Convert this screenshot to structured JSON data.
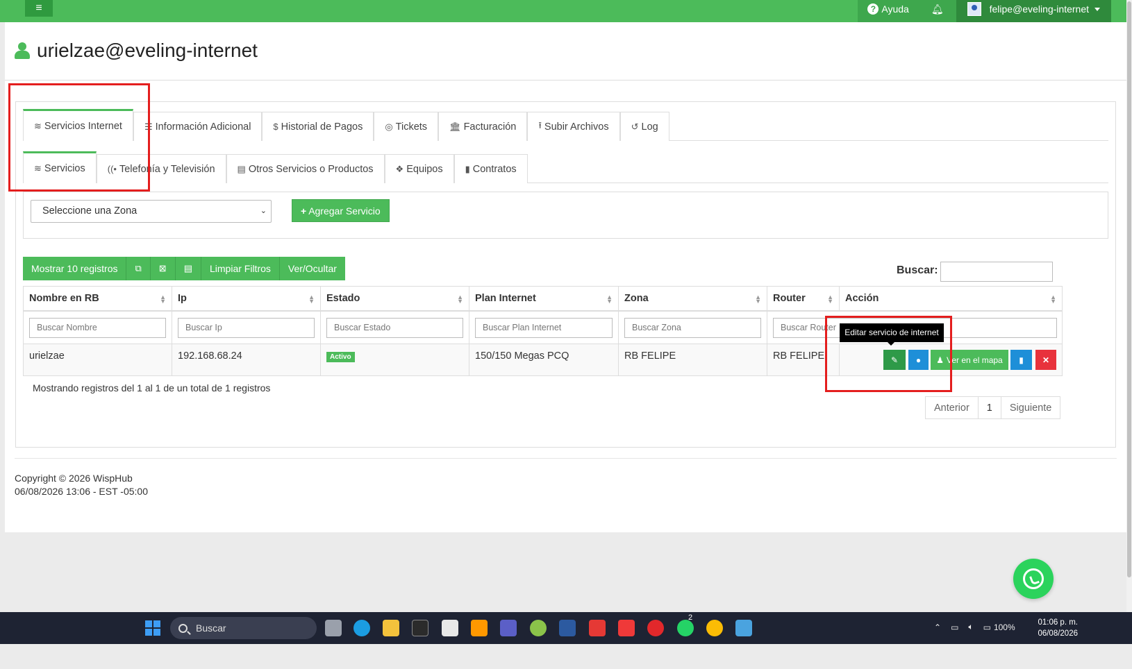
{
  "topbar": {
    "menu_icon": "hamburger-icon",
    "help_label": "Ayuda",
    "user_label": "felipe@eveling-internet"
  },
  "page": {
    "title": "urielzae@eveling-internet"
  },
  "tabs_primary": [
    {
      "label": "Servicios Internet",
      "icon": "wifi-icon"
    },
    {
      "label": "Información Adicional",
      "icon": "list-icon"
    },
    {
      "label": "Historial de Pagos",
      "icon": "dollar-icon"
    },
    {
      "label": "Tickets",
      "icon": "lifebuoy-icon"
    },
    {
      "label": "Facturación",
      "icon": "bank-icon"
    },
    {
      "label": "Subir Archivos",
      "icon": "upload-icon"
    },
    {
      "label": "Log",
      "icon": "history-icon"
    }
  ],
  "tabs_secondary": [
    {
      "label": "Servicios",
      "icon": "wifi-icon"
    },
    {
      "label": "Telefonía y Televisión",
      "icon": "broadcast-icon"
    },
    {
      "label": "Otros Servicios o Productos",
      "icon": "server-icon"
    },
    {
      "label": "Equipos",
      "icon": "cubes-icon"
    },
    {
      "label": "Contratos",
      "icon": "file-icon"
    }
  ],
  "filters": {
    "zone_select": "Seleccione una Zona",
    "add_service": "Agregar Servicio"
  },
  "toolbar": {
    "show_records": "Mostrar 10 registros",
    "copy_icon": "copy-icon",
    "excel_icon": "excel-icon",
    "csv_icon": "csv-icon",
    "clear_filters": "Limpiar Filtros",
    "toggle_columns": "Ver/Ocultar"
  },
  "search": {
    "label": "Buscar:"
  },
  "table": {
    "columns": [
      "Nombre en RB",
      "Ip",
      "Estado",
      "Plan Internet",
      "Zona",
      "Router",
      "Acción"
    ],
    "filter_placeholders": [
      "Buscar Nombre",
      "Buscar Ip",
      "Buscar Estado",
      "Buscar Plan Internet",
      "Buscar Zona",
      "Buscar Router"
    ],
    "rows": [
      {
        "nombre": "urielzae",
        "ip": "192.168.68.24",
        "estado": "Activo",
        "plan": "150/150 Megas PCQ",
        "zona": "RB FELIPE",
        "router": "RB FELIPE"
      }
    ],
    "actions": {
      "ver_mapa": "Ver en el mapa",
      "tooltip": "Editar servicio de internet"
    }
  },
  "pagination": {
    "info": "Mostrando registros del 1 al 1 de un total de 1 registros",
    "prev": "Anterior",
    "current": "1",
    "next": "Siguiente"
  },
  "footer": {
    "copyright": "Copyright © 2026 WispHub",
    "datetime": "06/08/2026 13:06 - EST -05:00"
  },
  "taskbar": {
    "search": "Buscar",
    "battery": "100%",
    "time": "01:06 p. m.",
    "date": "06/08/2026",
    "whatsapp_badge": "2"
  },
  "colors": {
    "brand_green": "#4cbb5a",
    "blue": "#1e8fd8",
    "red": "#e8323c",
    "highlight_red": "#e41e1e"
  }
}
